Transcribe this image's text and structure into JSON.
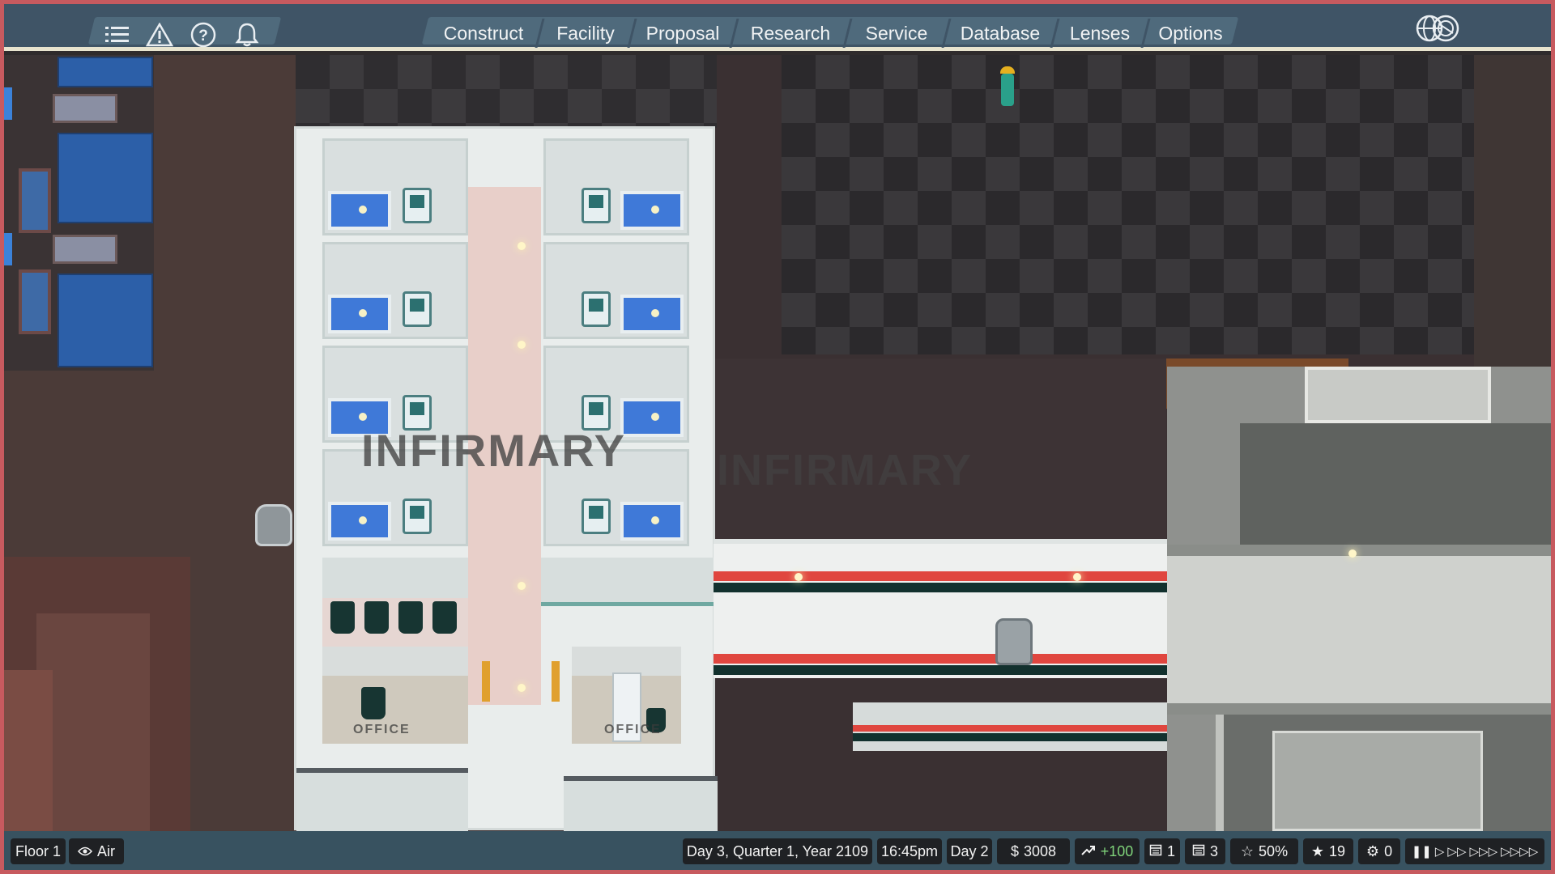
{
  "topbar": {
    "icons": [
      "list-icon",
      "warning-icon",
      "help-icon",
      "bell-icon"
    ],
    "tabs": [
      "Construct",
      "Facility",
      "Proposal",
      "Research",
      "Service",
      "Database",
      "Lenses",
      "Options"
    ],
    "globe_icon": "globe-icon"
  },
  "world": {
    "room_labels": [
      "INFIRMARY",
      "INFIRMARY"
    ],
    "office_labels": [
      "OFFICE",
      "OFFICE"
    ]
  },
  "status": {
    "floor": "Floor 1",
    "view": "Air",
    "date": "Day 3, Quarter 1, Year 2109",
    "time": "16:45pm",
    "day": "Day 2",
    "money": "3008",
    "income": "+100",
    "count_a": "1",
    "count_b": "3",
    "approval": "50%",
    "stars": "19",
    "gears": "0"
  },
  "speed_controls": [
    "pause",
    "play",
    "fast",
    "faster",
    "fastest"
  ],
  "colors": {
    "topbar": "#3f5466",
    "bottombar": "#385260",
    "frame_border": "#c75a5f",
    "bed_blue": "#3f79d8",
    "accent_teal": "#2c7070",
    "stripe_red": "#e0463f"
  }
}
